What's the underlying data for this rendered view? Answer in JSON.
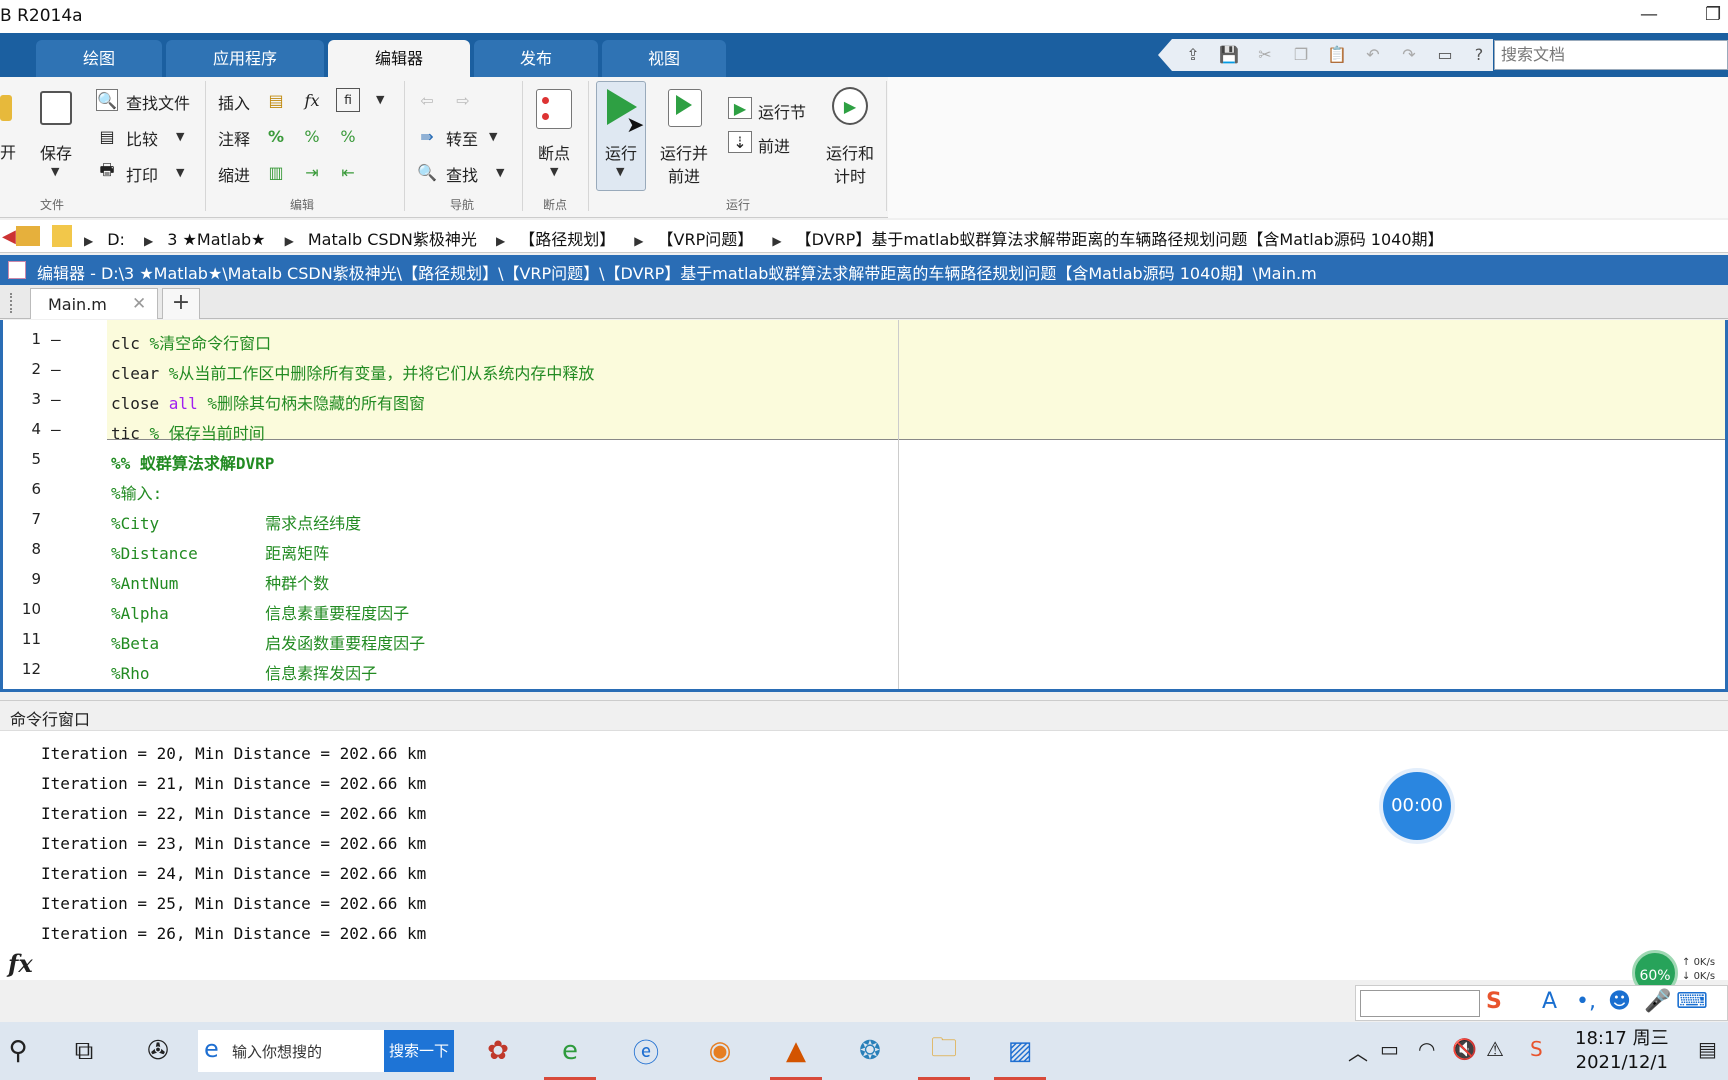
{
  "window": {
    "title": "B R2014a"
  },
  "tabs": [
    "绘图",
    "应用程序",
    "编辑器",
    "发布",
    "视图"
  ],
  "search": {
    "placeholder": "搜索文档"
  },
  "ribbon": {
    "file": {
      "open": "开",
      "save": "保存",
      "find_files": "查找文件",
      "compare": "比较",
      "print": "打印",
      "group": "文件"
    },
    "edit": {
      "insert": "插入",
      "comment": "注释",
      "indent": "缩进",
      "group": "编辑"
    },
    "navigate": {
      "goto": "转至",
      "find": "查找",
      "group": "导航"
    },
    "breakpoints": {
      "label": "断点",
      "group": "断点"
    },
    "run": {
      "run": "运行",
      "run_advance_1": "运行并",
      "run_advance_2": "前进",
      "run_section": "运行节",
      "advance": "前进",
      "run_time_1": "运行和",
      "run_time_2": "计时",
      "group": "运行"
    }
  },
  "breadcrumbs": [
    "D:",
    "3 ★Matlab★",
    "Matalb CSDN紫极神光",
    "【路径规划】",
    "【VRP问题】",
    "【DVRP】基于matlab蚁群算法求解带距离的车辆路径规划问题【含Matlab源码 1040期】"
  ],
  "editor": {
    "title": "编辑器 - D:\\3 ★Matlab★\\Matalb CSDN紫极神光\\【路径规划】\\【VRP问题】\\【DVRP】基于matlab蚁群算法求解带距离的车辆路径规划问题【含Matlab源码 1040期】\\Main.m",
    "file_tab": "Main.m",
    "add_tab": "+",
    "lines": [
      {
        "num": "1",
        "dash": "–",
        "code": "clc ",
        "kw": "",
        "rest": "",
        "comment": "%清空命令行窗口"
      },
      {
        "num": "2",
        "dash": "–",
        "code": "clear ",
        "kw": "",
        "rest": "",
        "comment": "%从当前工作区中删除所有变量，并将它们从系统内存中释放"
      },
      {
        "num": "3",
        "dash": "–",
        "code": "close ",
        "kw": "all",
        "rest": " ",
        "comment": "%删除其句柄未隐藏的所有图窗"
      },
      {
        "num": "4",
        "dash": "–",
        "code": "tic ",
        "kw": "",
        "rest": "",
        "comment": "% 保存当前时间"
      },
      {
        "num": "5",
        "dash": "",
        "section": "%% 蚁群算法求解DVRP"
      },
      {
        "num": "6",
        "dash": "",
        "code": "",
        "kw": "",
        "rest": "",
        "comment": "%输入:"
      },
      {
        "num": "7",
        "dash": "",
        "code": "",
        "kw": "",
        "rest": "",
        "comment": "%City           需求点经纬度"
      },
      {
        "num": "8",
        "dash": "",
        "code": "",
        "kw": "",
        "rest": "",
        "comment": "%Distance       距离矩阵"
      },
      {
        "num": "9",
        "dash": "",
        "code": "",
        "kw": "",
        "rest": "",
        "comment": "%AntNum         种群个数"
      },
      {
        "num": "10",
        "dash": "",
        "code": "",
        "kw": "",
        "rest": "",
        "comment": "%Alpha          信息素重要程度因子"
      },
      {
        "num": "11",
        "dash": "",
        "code": "",
        "kw": "",
        "rest": "",
        "comment": "%Beta           启发函数重要程度因子"
      },
      {
        "num": "12",
        "dash": "",
        "code": "",
        "kw": "",
        "rest": "",
        "comment": "%Rho            信息素挥发因子"
      }
    ]
  },
  "command_window": {
    "title": "命令行窗口",
    "output": [
      "Iteration = 20, Min Distance = 202.66 km",
      "Iteration = 21, Min Distance = 202.66 km",
      "Iteration = 22, Min Distance = 202.66 km",
      "Iteration = 23, Min Distance = 202.66 km",
      "Iteration = 24, Min Distance = 202.66 km",
      "Iteration = 25, Min Distance = 202.66 km",
      "Iteration = 26, Min Distance = 202.66 km"
    ],
    "prompt_icon": "fx"
  },
  "overlay": {
    "timer": "00:00",
    "percent": "60%",
    "net_up": "0K/s",
    "net_down": "0K/s"
  },
  "taskbar": {
    "search_text": "输入你想搜的",
    "search_button": "搜索一下",
    "time": "18:17 周三",
    "date": "2021/12/1"
  },
  "colors": {
    "ribbon_blue": "#1b5fa0",
    "editor_blue": "#2a6db5",
    "comment_green": "#228b22",
    "keyword_purple": "#a020f0"
  }
}
